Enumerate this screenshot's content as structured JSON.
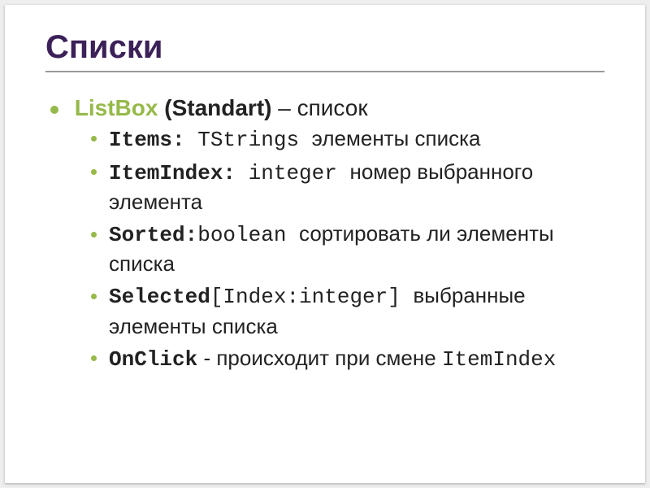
{
  "title": "Списки",
  "main": {
    "term": "ListBox",
    "category": "(Standart)",
    "dash": " – ",
    "desc": "список"
  },
  "items": [
    {
      "prop": "Items:",
      "type": " TStrings ",
      "desc": "элементы списка"
    },
    {
      "prop": "ItemIndex:",
      "type": " integer ",
      "desc": "номер выбранного элемента"
    },
    {
      "prop": "Sorted:",
      "type": "boolean ",
      "desc": "сортировать ли элементы списка"
    },
    {
      "prop": "Selected",
      "type": "[Index:integer] ",
      "desc": "выбранные элементы списка"
    },
    {
      "prop": "OnClick",
      "dash": " - ",
      "desc": "происходит при смене ",
      "tail": "ItemIndex"
    }
  ]
}
